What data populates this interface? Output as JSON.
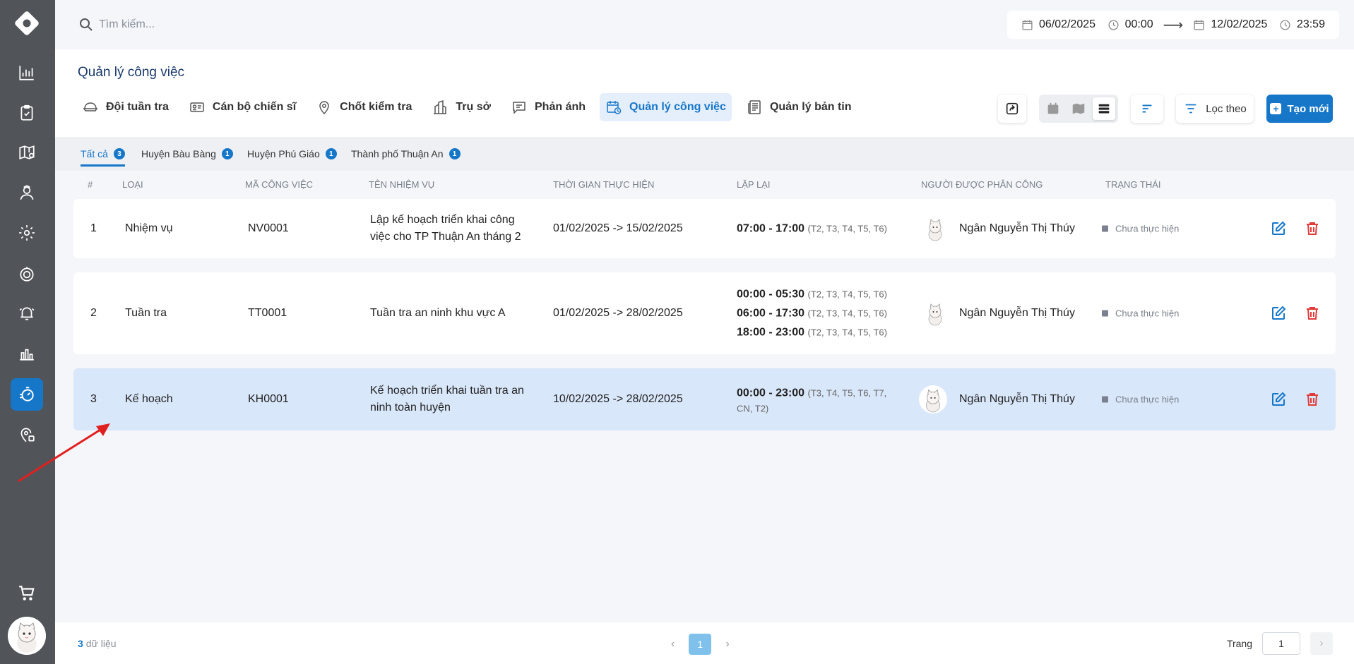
{
  "search": {
    "placeholder": "Tìm kiếm..."
  },
  "date_range": {
    "start_date": "06/02/2025",
    "start_time": "00:00",
    "arrow": "⟶",
    "end_date": "12/02/2025",
    "end_time": "23:59"
  },
  "page": {
    "title": "Quản lý công việc"
  },
  "tabs": [
    {
      "label": "Đội tuần tra",
      "icon": "patrol-cap-icon"
    },
    {
      "label": "Cán bộ chiến sĩ",
      "icon": "id-card-icon"
    },
    {
      "label": "Chốt kiểm tra",
      "icon": "map-pin-icon"
    },
    {
      "label": "Trụ sở",
      "icon": "building-icon"
    },
    {
      "label": "Phản ánh",
      "icon": "chat-icon"
    },
    {
      "label": "Quản lý công việc",
      "icon": "calendar-clock-icon",
      "active": true
    },
    {
      "label": "Quản lý bản tin",
      "icon": "newspaper-icon"
    }
  ],
  "toolbar": {
    "filter_label": "Lọc theo",
    "create_label": "Tạo mới",
    "create_plus": "+"
  },
  "chips": [
    {
      "label": "Tất cả",
      "count": "3",
      "active": true
    },
    {
      "label": "Huyện Bàu Bàng",
      "count": "1"
    },
    {
      "label": "Huyện Phú Giáo",
      "count": "1"
    },
    {
      "label": "Thành phố Thuận An",
      "count": "1"
    }
  ],
  "columns": {
    "index": "#",
    "type": "Loại",
    "code": "Mã công việc",
    "task_name": "Tên nhiệm vụ",
    "period": "Thời gian thực hiện",
    "repeat": "Lặp lại",
    "assignee": "Người được phân công",
    "status": "Trạng thái"
  },
  "rows": [
    {
      "index": "1",
      "type": "Nhiệm vụ",
      "code": "NV0001",
      "task_name_1": "Lập kế hoạch triển khai công",
      "task_name_2": "việc cho TP Thuận An tháng 2",
      "period": "01/02/2025 -> 15/02/2025",
      "repeat": [
        {
          "time": "07:00 - 17:00",
          "days": "(T2, T3, T4, T5, T6)"
        }
      ],
      "assignee": "Ngân Nguyễn Thị Thúy",
      "status": "Chưa thực hiện"
    },
    {
      "index": "2",
      "type": "Tuần tra",
      "code": "TT0001",
      "task_name_1": "Tuần tra an ninh khu vực A",
      "task_name_2": "",
      "period": "01/02/2025 -> 28/02/2025",
      "repeat": [
        {
          "time": "00:00 - 05:30",
          "days": "(T2, T3, T4, T5, T6)"
        },
        {
          "time": "06:00 - 17:30",
          "days": "(T2, T3, T4, T5, T6)"
        },
        {
          "time": "18:00 - 23:00",
          "days": "(T2, T3, T4, T5, T6)"
        }
      ],
      "assignee": "Ngân Nguyễn Thị Thúy",
      "status": "Chưa thực hiện"
    },
    {
      "index": "3",
      "type": "Kế hoạch",
      "code": "KH0001",
      "task_name_1": "Kế hoạch triển khai tuần tra an",
      "task_name_2": "ninh toàn huyện",
      "period": "10/02/2025 -> 28/02/2025",
      "repeat": [
        {
          "time": "00:00 - 23:00",
          "days": "(T3, T4, T5, T6, T7,",
          "days_2": "CN, T2)"
        }
      ],
      "assignee": "Ngân Nguyễn Thị Thúy",
      "status": "Chưa thực hiện"
    }
  ],
  "footer": {
    "record_count": "3",
    "record_label": "dữ liệu",
    "prev": "‹",
    "current_page": "1",
    "next": "›",
    "goto_label": "Trang",
    "goto_value": "1",
    "goto_next": "›"
  },
  "colors": {
    "accent": "#1677c9",
    "sidebar": "#515459",
    "highlight_row": "#d9e7fa",
    "delete": "#e23b3b",
    "annotation": "#e02020"
  }
}
